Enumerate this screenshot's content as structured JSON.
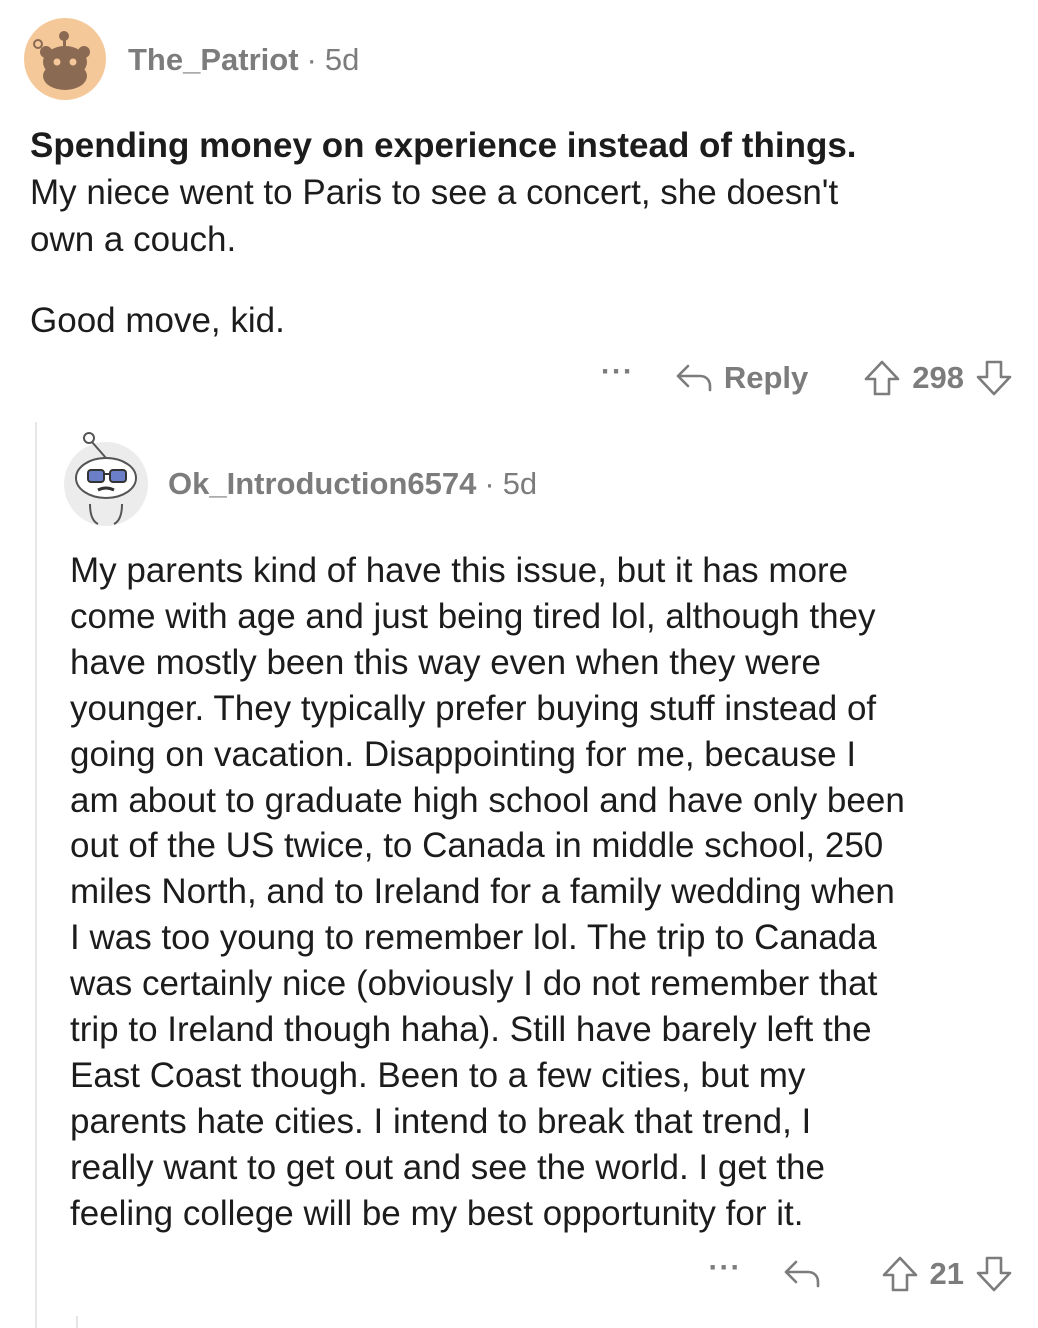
{
  "top_comment": {
    "username": "The_Patriot",
    "separator": "·",
    "age": "5d",
    "avatar_icon": "reddit-snoo-avatar-brown",
    "title": "Spending money on experience instead of things.",
    "body_line1": "My niece went to Paris to see a concert, she doesn't",
    "body_line2": "own a couch.",
    "body_line3": "Good move, kid.",
    "more_label": "···",
    "reply_label": "Reply",
    "score": "298"
  },
  "reply_comment": {
    "username": "Ok_Introduction6574",
    "separator": "·",
    "age": "5d",
    "avatar_icon": "reddit-snoo-avatar-glasses",
    "lines": [
      "My parents kind of have this issue, but it has more",
      "come with age and just being tired lol, although they",
      "have mostly been this way even when they were",
      "younger. They typically prefer buying stuff instead of",
      "going on vacation. Disappointing for me, because I",
      "am about to graduate high school and have only been",
      "out of the US twice, to Canada in middle school, 250",
      "miles North, and to Ireland for a family wedding when",
      "I was too young to remember lol. The trip to Canada",
      "was certainly nice (obviously I do not remember that",
      "trip to Ireland though haha). Still have barely left the",
      "East Coast though. Been to a few cities, but my",
      "parents hate cities. I intend to break that trend, I",
      "really want to get out and see the world. I get the",
      "feeling college will be my best opportunity for it."
    ],
    "more_label": "···",
    "score": "21"
  },
  "colors": {
    "text": "#1c1c1c",
    "meta": "#7c7c7c",
    "thread_line": "#e6e6e6",
    "avatar_bg_1": "#f5c89a",
    "avatar_bg_2": "#ececec"
  }
}
